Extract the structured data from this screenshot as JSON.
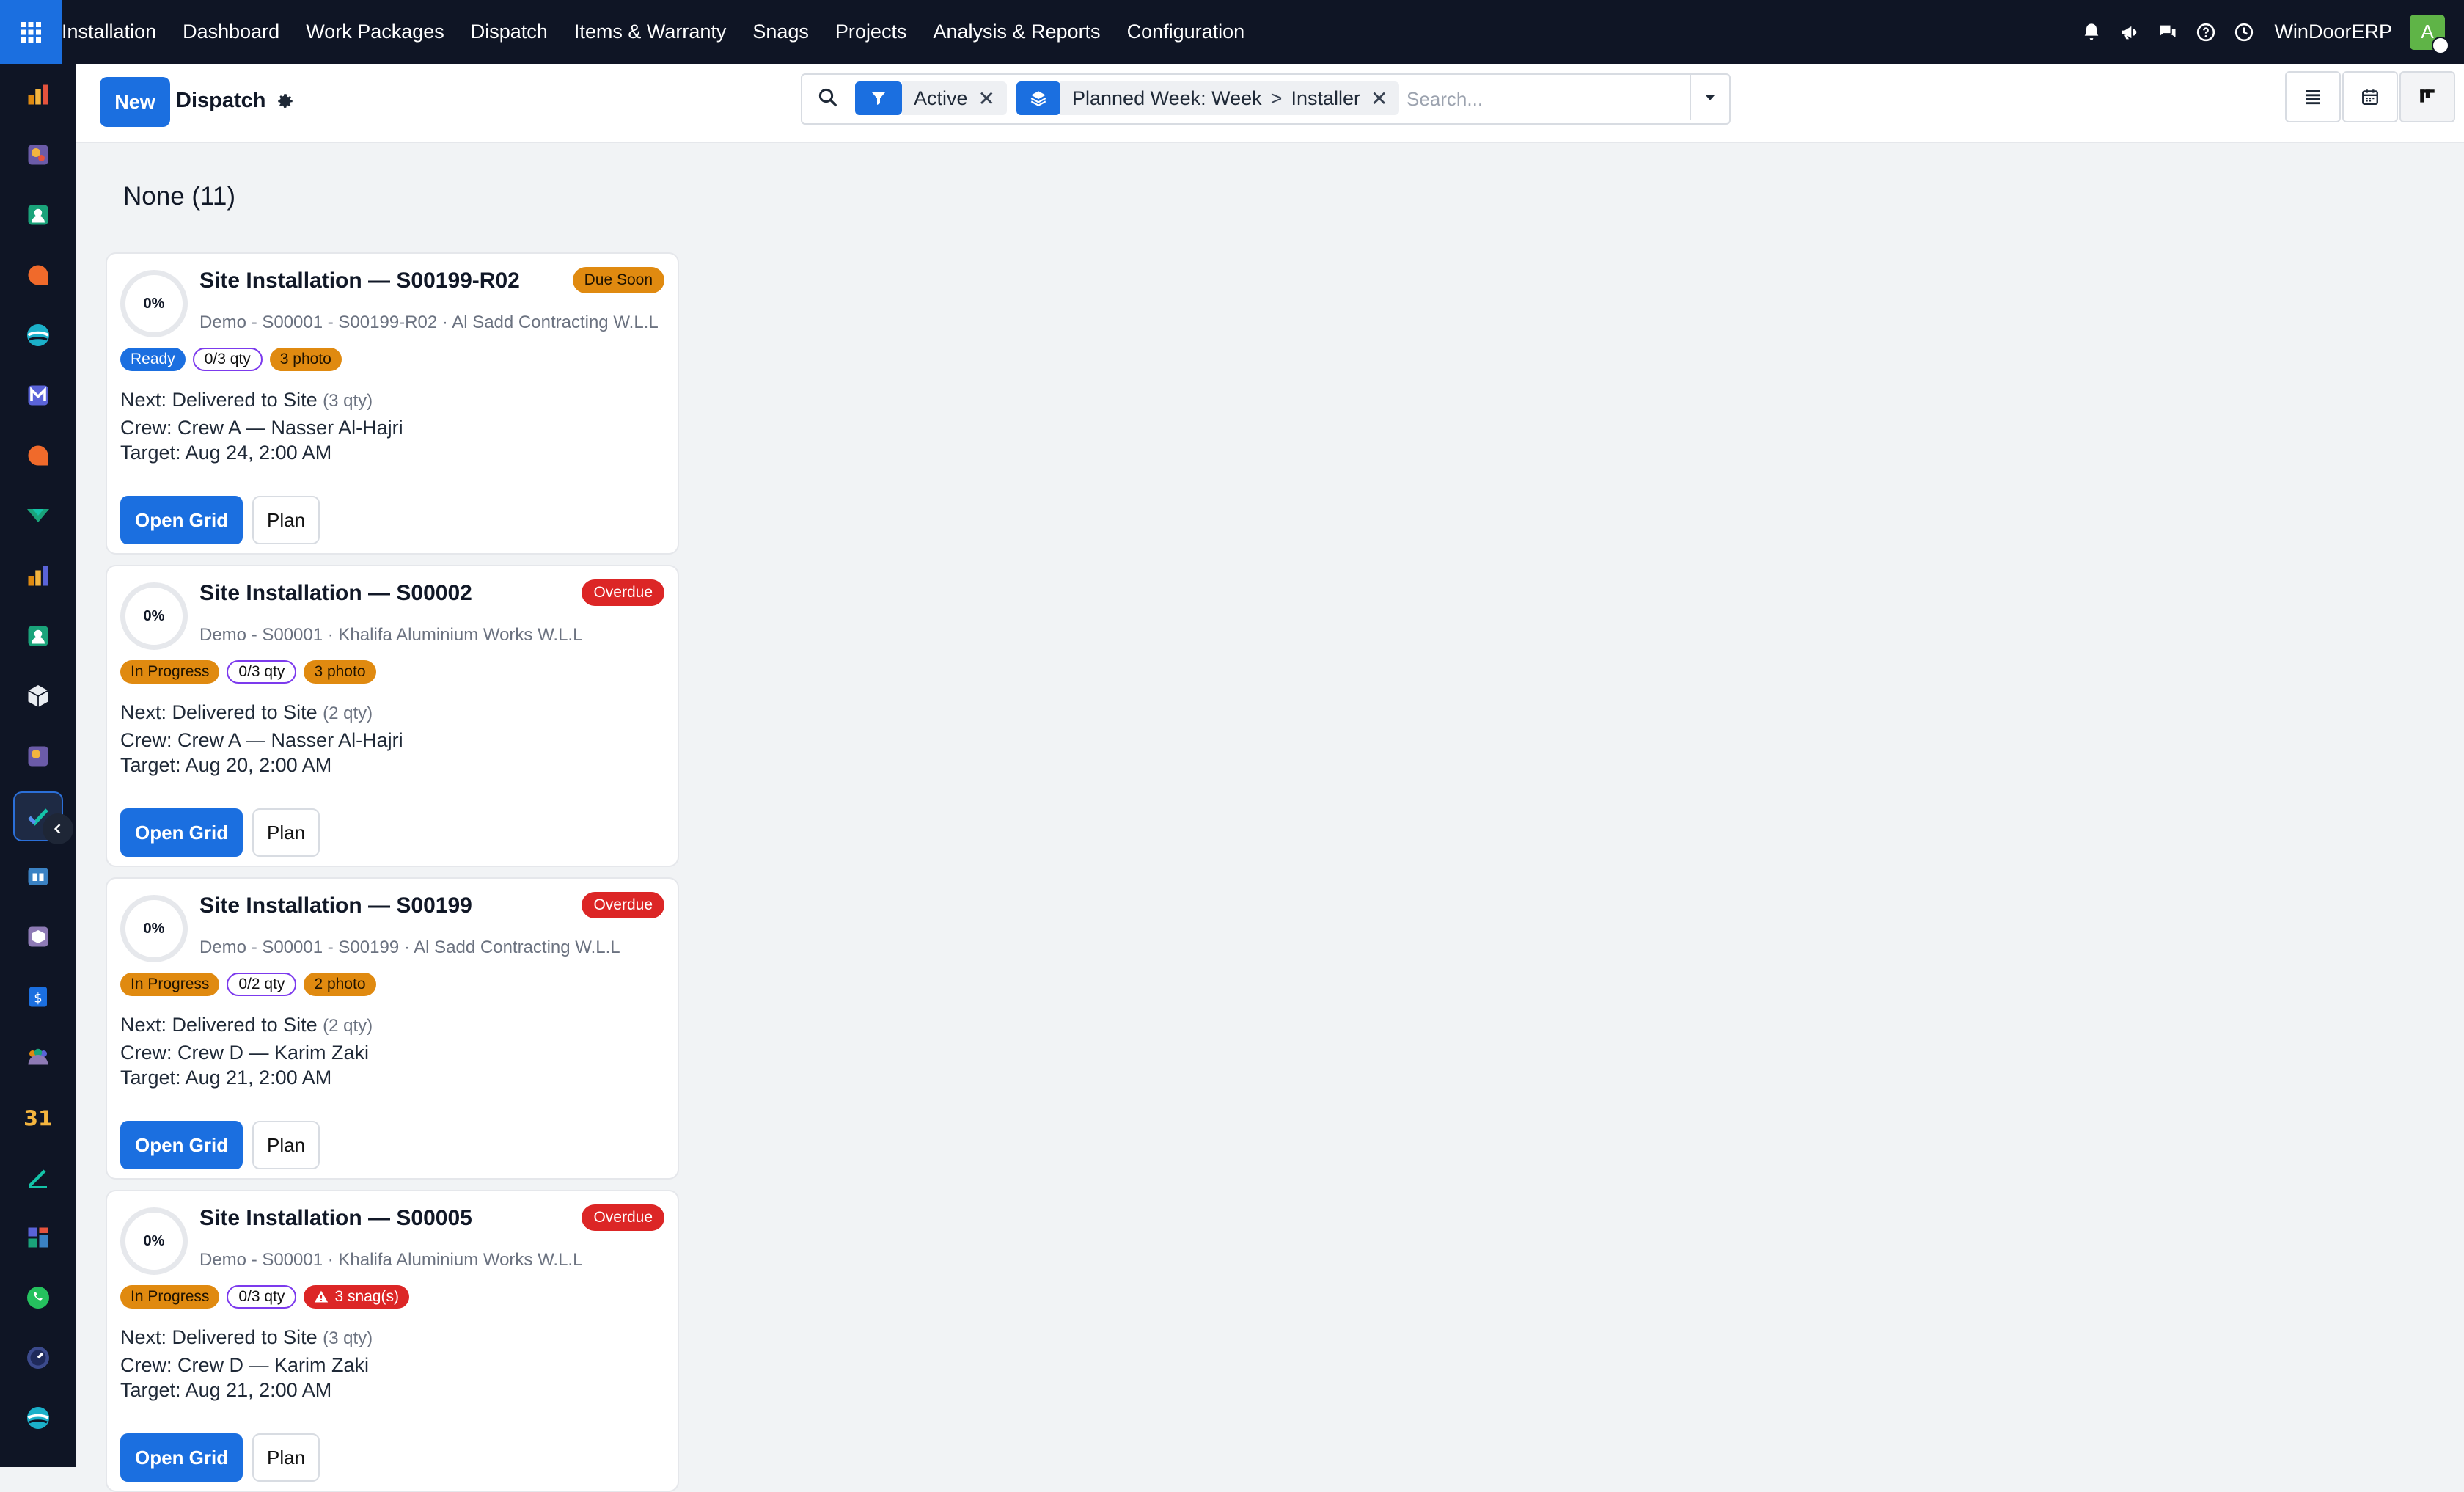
{
  "navbar": {
    "menu": [
      "Installation",
      "Dashboard",
      "Work Packages",
      "Dispatch",
      "Items & Warranty",
      "Snags",
      "Projects",
      "Analysis & Reports",
      "Configuration"
    ],
    "company": "WinDoorERP",
    "avatar_letter": "A"
  },
  "control": {
    "new_label": "New",
    "title": "Dispatch",
    "search": {
      "filter_label": "Active",
      "group_label_1": "Planned Week: Week",
      "group_sep": ">",
      "group_label_2": "Installer",
      "placeholder": "Search..."
    }
  },
  "column": {
    "title": "None (11)"
  },
  "cards": [
    {
      "progress": "0%",
      "title": "Site Installation — S00199-R02",
      "due": "Due Soon",
      "subtitle": "Demo - S00001 - S00199-R02 · Al Sadd Contracting W.L.L",
      "status": "Ready",
      "qty": "0/3 qty",
      "extra": "3 photo",
      "next": "Next: Delivered to Site",
      "next_qty": "(3 qty)",
      "crew": "Crew: Crew A — Nasser Al-Hajri",
      "target": "Target: Aug 24, 2:00 AM",
      "open_label": "Open Grid",
      "plan_label": "Plan"
    },
    {
      "progress": "0%",
      "title": "Site Installation — S00002",
      "due": "Overdue",
      "subtitle": "Demo - S00001 · Khalifa Aluminium Works W.L.L",
      "status": "In Progress",
      "qty": "0/3 qty",
      "extra": "3 photo",
      "next": "Next: Delivered to Site",
      "next_qty": "(2 qty)",
      "crew": "Crew: Crew A — Nasser Al-Hajri",
      "target": "Target: Aug 20, 2:00 AM",
      "open_label": "Open Grid",
      "plan_label": "Plan"
    },
    {
      "progress": "0%",
      "title": "Site Installation — S00199",
      "due": "Overdue",
      "subtitle": "Demo - S00001 - S00199 · Al Sadd Contracting W.L.L",
      "status": "In Progress",
      "qty": "0/2 qty",
      "extra": "2 photo",
      "next": "Next: Delivered to Site",
      "next_qty": "(2 qty)",
      "crew": "Crew: Crew D — Karim Zaki",
      "target": "Target: Aug 21, 2:00 AM",
      "open_label": "Open Grid",
      "plan_label": "Plan"
    },
    {
      "progress": "0%",
      "title": "Site Installation — S00005",
      "due": "Overdue",
      "subtitle": "Demo - S00001 · Khalifa Aluminium Works W.L.L",
      "status": "In Progress",
      "qty": "0/3 qty",
      "extra": "3 snag(s)",
      "next": "Next: Delivered to Site",
      "next_qty": "(3 qty)",
      "crew": "Crew: Crew D — Karim Zaki",
      "target": "Target: Aug 21, 2:00 AM",
      "open_label": "Open Grid",
      "plan_label": "Plan"
    }
  ],
  "colors": {
    "primary": "#1b6fe0",
    "warning": "#e08a10",
    "danger": "#dc2626",
    "navbar": "#0f1525"
  }
}
